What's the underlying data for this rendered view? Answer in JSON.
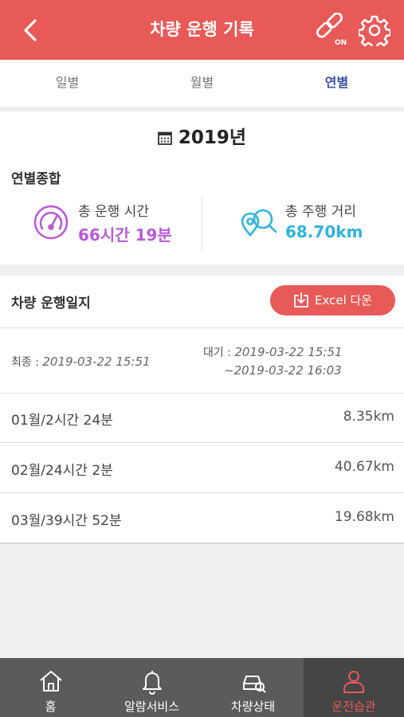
{
  "header": {
    "title": "차량 운행 기록",
    "link_status": "ON"
  },
  "tabs": [
    {
      "label": "일별",
      "active": false
    },
    {
      "label": "월별",
      "active": false
    },
    {
      "label": "연별",
      "active": true
    }
  ],
  "summary": {
    "year": "2019년",
    "section_label": "연별종합",
    "total_time_label": "총 운행 시간",
    "total_time_value": "66시간 19분",
    "total_distance_label": "총 주행 거리",
    "total_distance_value": "68.70km"
  },
  "log": {
    "title": "차량 운행일지",
    "excel_button": "Excel 다운",
    "last_label": "최종 :",
    "last_value": "2019-03-22 15:51",
    "wait_label": "대기 :",
    "wait_start": "2019-03-22 15:51",
    "wait_end": "~2019-03-22 16:03",
    "rows": [
      {
        "period": "01월/2시간 24분",
        "distance": "8.35km"
      },
      {
        "period": "02월/24시간 2분",
        "distance": "40.67km"
      },
      {
        "period": "03월/39시간 52분",
        "distance": "19.68km"
      }
    ]
  },
  "nav": [
    {
      "label": "홈",
      "icon": "home-icon",
      "active": false
    },
    {
      "label": "알람서비스",
      "icon": "bell-icon",
      "active": false
    },
    {
      "label": "차량상태",
      "icon": "car-search-icon",
      "active": false
    },
    {
      "label": "운전습관",
      "icon": "driver-icon",
      "active": true
    }
  ],
  "colors": {
    "accent": "#e85a57",
    "tab_active": "#3d4fa8",
    "time": "#b95bd6",
    "distance": "#2fb4dc",
    "nav_bg": "#5b5b5b"
  }
}
